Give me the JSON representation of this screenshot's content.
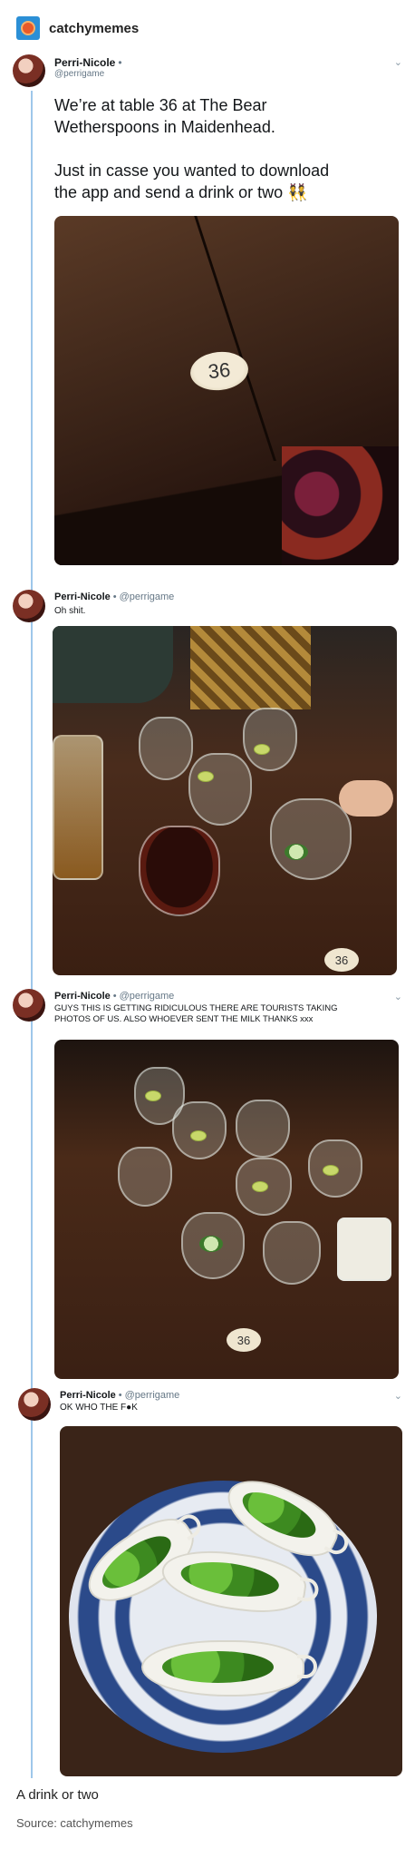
{
  "blog": {
    "name": "catchymemes",
    "avatar_icon": "blog-avatar-icon"
  },
  "tweets": [
    {
      "name": "Perri-Nicole",
      "separator": "•",
      "handle": "@perrigame",
      "text": "We’re at table 36 at The Bear\nWetherspoons in Maidenhead.\n\nJust in casse you wanted to download\nthe app and send a drink or two 👯",
      "image_tag": "36"
    },
    {
      "name": "Perri-Nicole",
      "separator": "•",
      "handle": "@perrigame",
      "text": "Oh shit.",
      "image_tag": "36"
    },
    {
      "name": "Perri-Nicole",
      "separator": "•",
      "handle": "@perrigame",
      "text": "GUYS THIS IS GETTING RIDICULOUS THERE ARE TOURISTS TAKING\nPHOTOS OF US. ALSO WHOEVER SENT THE MILK THANKS xxx",
      "image_tag": "36"
    },
    {
      "name": "Perri-Nicole",
      "separator": "•",
      "handle": "@perrigame",
      "text": "OK WHO THE F●K"
    }
  ],
  "caption": "A drink or two",
  "source": "Source: catchymemes",
  "colors": {
    "thread_line": "#9ec7ea",
    "handle": "#657786",
    "link_blue": "#2b8fd6"
  }
}
